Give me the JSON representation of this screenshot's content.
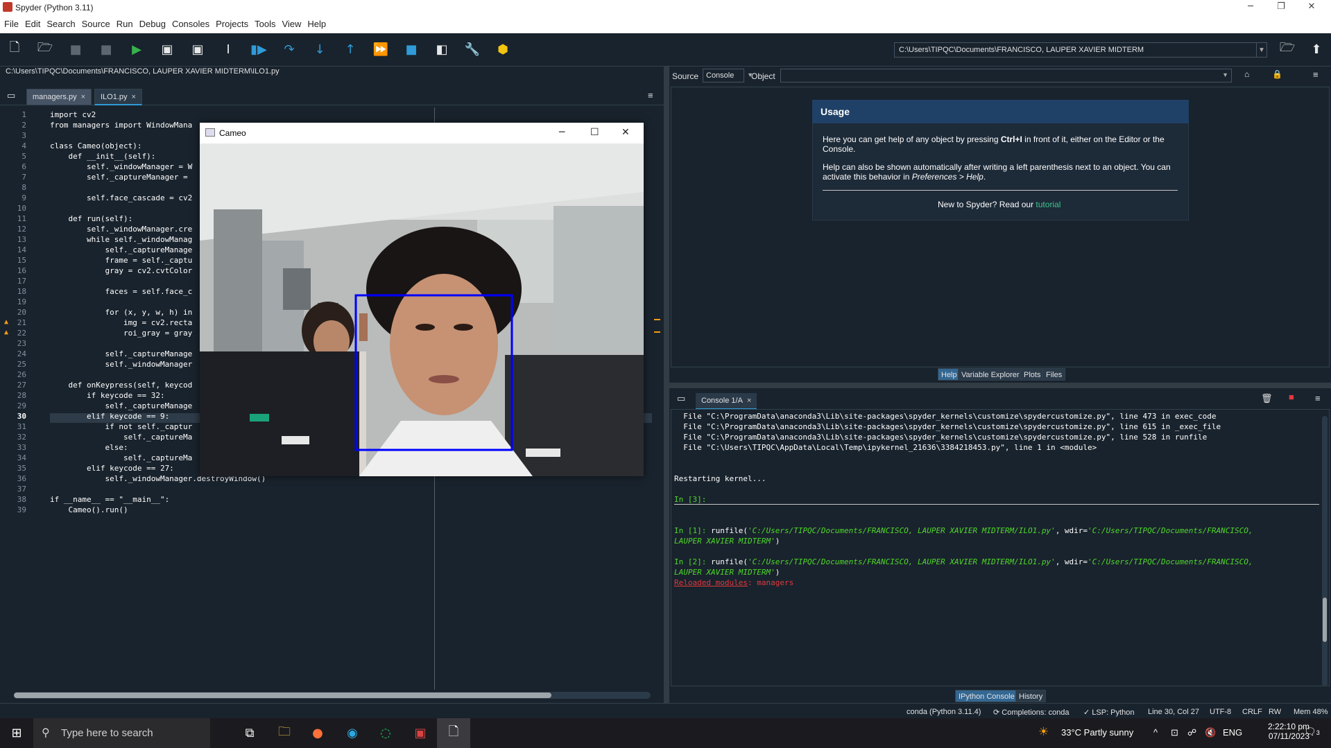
{
  "window": {
    "title": "Spyder (Python 3.11)"
  },
  "menu": [
    "File",
    "Edit",
    "Search",
    "Source",
    "Run",
    "Debug",
    "Consoles",
    "Projects",
    "Tools",
    "View",
    "Help"
  ],
  "toolbar": {
    "icons": [
      "new-file-icon",
      "open-file-icon",
      "save-icon",
      "save-all-icon",
      "run-icon",
      "run-cell-icon",
      "run-cell-advance-icon",
      "run-selection-icon",
      "debug-icon",
      "step-over-icon",
      "step-into-icon",
      "step-return-icon",
      "continue-icon",
      "stop-icon",
      "maximize-pane-icon",
      "preferences-icon",
      "python-path-icon"
    ],
    "path": "C:\\Users\\TIPQC\\Documents\\FRANCISCO, LAUPER XAVIER MIDTERM"
  },
  "editor": {
    "filepath": "C:\\Users\\TIPQC\\Documents\\FRANCISCO, LAUPER XAVIER MIDTERM\\ILO1.py",
    "tabs": [
      "managers.py",
      "ILO1.py"
    ],
    "active_tab": 1,
    "current_line": 30,
    "warning_lines": [
      21,
      22
    ],
    "lines": [
      "import cv2",
      "from managers import WindowMana",
      "",
      "class Cameo(object):",
      "    def __init__(self):",
      "        self._windowManager = W",
      "        self._captureManager = ",
      "",
      "        self.face_cascade = cv2",
      "",
      "    def run(self):",
      "        self._windowManager.cre",
      "        while self._windowManag",
      "            self._captureManage",
      "            frame = self._captu",
      "            gray = cv2.cvtColor",
      "",
      "            faces = self.face_c",
      "",
      "            for (x, y, w, h) in",
      "                img = cv2.recta",
      "                roi_gray = gray",
      "",
      "            self._captureManage",
      "            self._windowManager",
      "",
      "    def onKeypress(self, keycod",
      "        if keycode == 32:",
      "            self._captureManage",
      "        elif keycode == 9:",
      "            if not self._captur",
      "                self._captureMa",
      "            else:",
      "                self._captureMa",
      "        elif keycode == 27:",
      "            self._windowManager.destroyWindow()",
      "",
      "if __name__ == \"__main__\":",
      "    Cameo().run()"
    ]
  },
  "cameo_window": {
    "title": "Cameo"
  },
  "help": {
    "source_label": "Source",
    "source_value": "Console",
    "object_label": "Object",
    "usage_title": "Usage",
    "para1_a": "Here you can get help of any object by pressing ",
    "para1_key": "Ctrl+I",
    "para1_b": " in front of it, either on the Editor or the",
    "para1_c": "Console.",
    "para2_a": "Help can also be shown automatically after writing a left parenthesis next to an object. You can",
    "para2_b": "activate this behavior in ",
    "para2_pref": "Preferences > Help",
    "para2_end": ".",
    "new_text": "New to Spyder? Read our ",
    "tutorial": "tutorial",
    "tabs": [
      "Help",
      "Variable Explorer",
      "Plots",
      "Files"
    ]
  },
  "console": {
    "tab_label": "Console 1/A",
    "trace": [
      "  File \"C:\\ProgramData\\anaconda3\\Lib\\site-packages\\spyder_kernels\\customize\\spydercustomize.py\", line 473 in exec_code",
      "  File \"C:\\ProgramData\\anaconda3\\Lib\\site-packages\\spyder_kernels\\customize\\spydercustomize.py\", line 615 in _exec_file",
      "  File \"C:\\ProgramData\\anaconda3\\Lib\\site-packages\\spyder_kernels\\customize\\spydercustomize.py\", line 528 in runfile",
      "  File \"C:\\Users\\TIPQC\\AppData\\Local\\Temp\\ipykernel_21636\\3384218453.py\", line 1 in <module>"
    ],
    "restarting": "Restarting kernel...",
    "in3": "In [3]:",
    "in1_prompt": "In [1]: ",
    "in2_prompt": "In [2]: ",
    "cmd_a": "runfile(",
    "cmd_path": "'C:/Users/TIPQC/Documents/FRANCISCO, LAUPER XAVIER MIDTERM/ILO1.py'",
    "cmd_b": ", wdir=",
    "cmd_wdir1": "'C:/Users/TIPQC/Documents/FRANCISCO,",
    "cmd_wdir2": "LAUPER XAVIER MIDTERM'",
    "cmd_end": ")",
    "reloaded_label": "Reloaded modules",
    "reloaded_value": ": managers",
    "tabs": [
      "IPython Console",
      "History"
    ]
  },
  "status": {
    "env": "conda (Python 3.11.4)",
    "completions": "Completions: conda",
    "lsp": "LSP: Python",
    "position": "Line 30, Col 27",
    "encoding": "UTF-8",
    "eol": "CRLF",
    "rw": "RW",
    "mem": "Mem 48%"
  },
  "taskbar": {
    "search_placeholder": "Type here to search",
    "weather": "33°C  Partly sunny",
    "lang": "ENG",
    "time": "2:22:10 pm",
    "date": "07/11/2023",
    "notifications": "3"
  }
}
